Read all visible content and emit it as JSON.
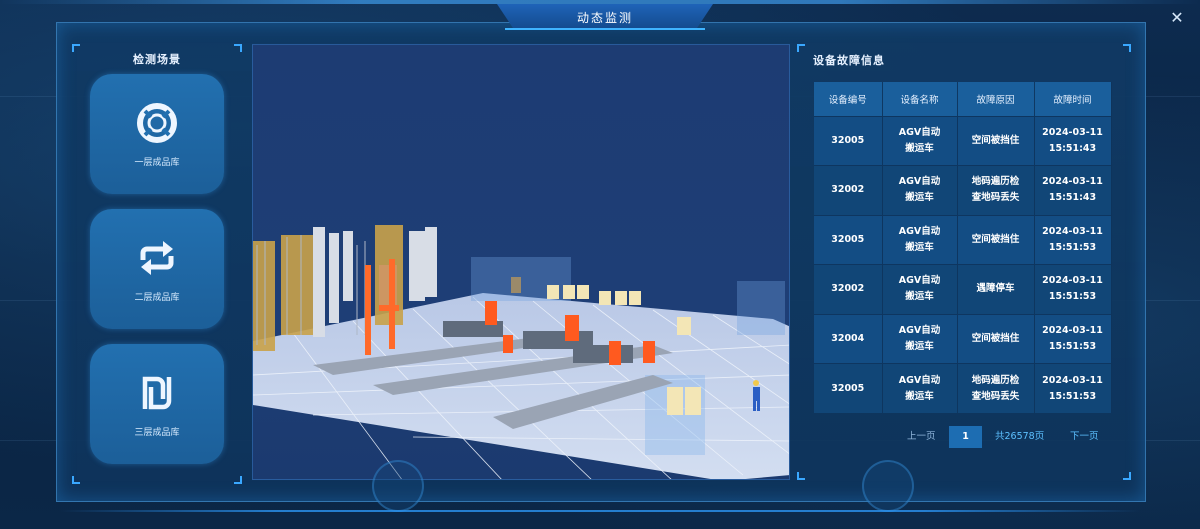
{
  "window": {
    "title": "动态监测",
    "close_glyph": "✕"
  },
  "left_panel": {
    "title": "检测场景",
    "scenes": [
      {
        "label": "一层成品库",
        "icon": "lifebuoy-icon"
      },
      {
        "label": "二层成品库",
        "icon": "repeat-arrows-icon"
      },
      {
        "label": "三层成品库",
        "icon": "shekel-icon"
      }
    ]
  },
  "viewport": {
    "content": "3d-warehouse-scene"
  },
  "fault_panel": {
    "title": "设备故障信息",
    "columns": [
      "设备编号",
      "设备名称",
      "故障原因",
      "故障时间"
    ],
    "rows": [
      {
        "id": "32005",
        "name_1": "AGV自动",
        "name_2": "搬运车",
        "reason_1": "空间被挡住",
        "reason_2": "",
        "date": "2024-03-11",
        "time": "15:51:43"
      },
      {
        "id": "32002",
        "name_1": "AGV自动",
        "name_2": "搬运车",
        "reason_1": "地码遍历检",
        "reason_2": "查地码丢失",
        "date": "2024-03-11",
        "time": "15:51:43"
      },
      {
        "id": "32005",
        "name_1": "AGV自动",
        "name_2": "搬运车",
        "reason_1": "空间被挡住",
        "reason_2": "",
        "date": "2024-03-11",
        "time": "15:51:53"
      },
      {
        "id": "32002",
        "name_1": "AGV自动",
        "name_2": "搬运车",
        "reason_1": "遇障停车",
        "reason_2": "",
        "date": "2024-03-11",
        "time": "15:51:53"
      },
      {
        "id": "32004",
        "name_1": "AGV自动",
        "name_2": "搬运车",
        "reason_1": "空间被挡住",
        "reason_2": "",
        "date": "2024-03-11",
        "time": "15:51:53"
      },
      {
        "id": "32005",
        "name_1": "AGV自动",
        "name_2": "搬运车",
        "reason_1": "地码遍历检",
        "reason_2": "查地码丢失",
        "date": "2024-03-11",
        "time": "15:51:53"
      }
    ],
    "pager": {
      "prev": "上一页",
      "current": "1",
      "total": "共26578页",
      "next": "下一页"
    }
  },
  "colors": {
    "accent": "#3aa8ff",
    "panel": "#134d84",
    "header": "#1a5f9c",
    "link": "#5cc0ff"
  }
}
